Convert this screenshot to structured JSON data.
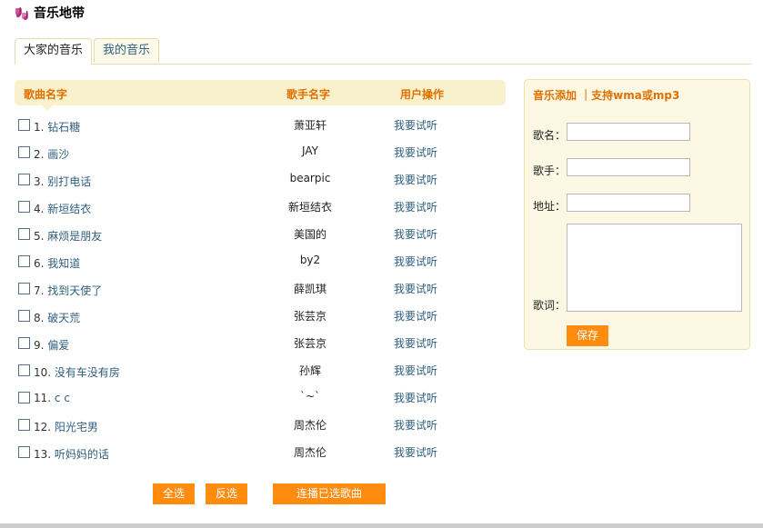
{
  "site": {
    "title": "音乐地带",
    "logo_icon": "music-notes-icon"
  },
  "tabs": [
    {
      "label": "大家的音乐",
      "active": true
    },
    {
      "label": "我的音乐",
      "active": false
    }
  ],
  "list": {
    "headers": {
      "song": "歌曲名字",
      "singer": "歌手名字",
      "action": "用户操作"
    },
    "rows": [
      {
        "num": "1.",
        "title": "钻石糖",
        "singer": "萧亚轩",
        "action": "我要试听"
      },
      {
        "num": "2.",
        "title": "画沙",
        "singer": "JAY",
        "action": "我要试听"
      },
      {
        "num": "3.",
        "title": "别打电话",
        "singer": "bearpic",
        "action": "我要试听"
      },
      {
        "num": "4.",
        "title": "新垣结衣",
        "singer": "新垣结衣",
        "action": "我要试听"
      },
      {
        "num": "5.",
        "title": "麻烦是朋友",
        "singer": "美国的",
        "action": "我要试听"
      },
      {
        "num": "6.",
        "title": "我知道",
        "singer": "by2",
        "action": "我要试听"
      },
      {
        "num": "7.",
        "title": "找到天使了",
        "singer": "薛凯琪",
        "action": "我要试听"
      },
      {
        "num": "8.",
        "title": "破天荒",
        "singer": "张芸京",
        "action": "我要试听"
      },
      {
        "num": "9.",
        "title": "偏爱",
        "singer": "张芸京",
        "action": "我要试听"
      },
      {
        "num": "10.",
        "title": "没有车没有房",
        "singer": "孙辉",
        "action": "我要试听"
      },
      {
        "num": "11.",
        "title": "c c",
        "singer": "`~`",
        "action": "我要试听"
      },
      {
        "num": "12.",
        "title": "阳光宅男",
        "singer": "周杰伦",
        "action": "我要试听"
      },
      {
        "num": "13.",
        "title": "听妈妈的话",
        "singer": "周杰伦",
        "action": "我要试听"
      }
    ],
    "buttons": {
      "select_all": "全选",
      "invert": "反选",
      "play_selected": "连播已选歌曲"
    }
  },
  "panel": {
    "title": "音乐添加 ｜支持wma或mp3",
    "name_label": "歌名：",
    "singer_label": "歌手：",
    "url_label": "地址：",
    "lyrics_label": "歌词：",
    "name_value": "",
    "singer_value": "",
    "url_value": "",
    "lyrics_value": "",
    "save_label": "保存"
  },
  "colors": {
    "accent_orange": "#ff8c0f",
    "header_text": "#e07000",
    "header_bg": "#f8f1cc",
    "link_blue": "#2f5f7f"
  }
}
